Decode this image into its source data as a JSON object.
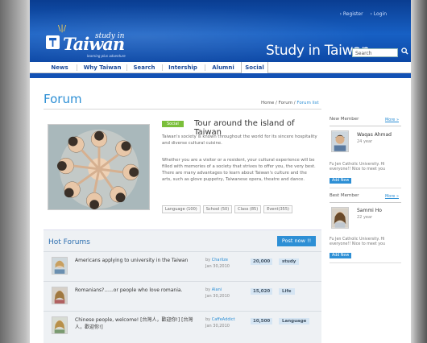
{
  "header": {
    "register": "› Register",
    "login": "› Login",
    "logo_top": "study in",
    "logo_name": "Taiwan",
    "logo_tagline": "learning plus adventure",
    "site_title": "Study in Taiwan",
    "search_placeholder": "Search"
  },
  "nav": [
    "News",
    "Why Taiwan",
    "Search",
    "Intership",
    "Alumni",
    "Social"
  ],
  "forum": {
    "title": "Forum",
    "crumb_home": "Home",
    "crumb_forum": "Forum",
    "crumb_current": "Forum list",
    "feature": {
      "badge": "Social",
      "title": "Tour around the island of Taiwan",
      "p1": "Taiwan's society is known throughout the world for its sincere hospitality and diverse cultural cuisine.",
      "p2": "Whether you are a visitor or a resident, your cultural experience will be filled with memories of a society that strives to offer you, the very best. There are many advantages to learn about Taiwan's culture and the arts, such as glove puppetry, Taiwanese opera, theatre and dance.",
      "tags": [
        "Language (100)",
        "School (50)",
        "Class (85)",
        "Event(355)"
      ]
    }
  },
  "hot": {
    "title": "Hot Forums",
    "post_button": "Post now !!",
    "rows": [
      {
        "topic": "Americans applying to university in the Taiwan",
        "by": "by",
        "author": "Charlize",
        "date": "Jan 30,2010",
        "count": "20,000",
        "category": "study"
      },
      {
        "topic": "Romanians?......or people who love romania.",
        "by": "by",
        "author": "Alani",
        "date": "Jan 30,2010",
        "count": "15,020",
        "category": "Life"
      },
      {
        "topic": "Chinese people, welcome! [台灣人，歡迎你!] [台灣人，歡迎你!]",
        "by": "by",
        "author": "CaffeAddict",
        "date": "Jan 30,2010",
        "count": "10,500",
        "category": "Language"
      }
    ]
  },
  "sidebar": {
    "new_member": {
      "title": "New Member",
      "more": "More »",
      "name": "Waqas Ahmad",
      "age": "24 year",
      "message": "Fu Jen Catholic University. Hi everyone!! Nice to meet you",
      "add": "Add New"
    },
    "best_member": {
      "title": "Best Member",
      "more": "More »",
      "name": "Sammi Ho",
      "age": "22 year",
      "message": "Fu Jen Catholic University. Hi everyone!! Nice to meet you",
      "add": "Add New"
    }
  },
  "colors": {
    "brand_blue": "#1351b4",
    "accent": "#2d8fd5",
    "badge_green": "#7bbf3a"
  }
}
